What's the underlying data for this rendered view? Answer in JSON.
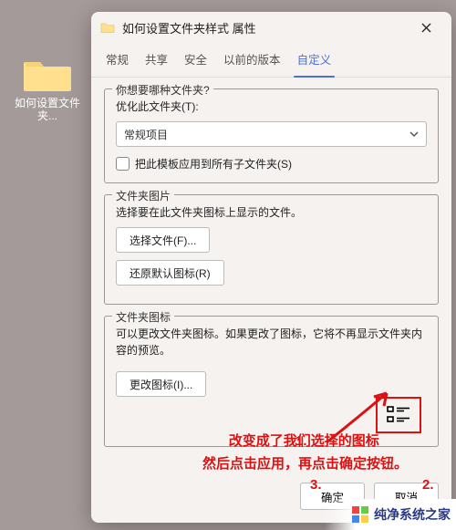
{
  "desktop": {
    "folder_label": "如何设置文件夹..."
  },
  "window": {
    "title": "如何设置文件夹样式 属性",
    "tabs": [
      "常规",
      "共享",
      "安全",
      "以前的版本",
      "自定义"
    ],
    "active_tab": 4,
    "group_template": {
      "legend": "你想要哪种文件夹?",
      "optimize_label": "优化此文件夹(T):",
      "select_value": "常规项目",
      "apply_cb_label": "把此模板应用到所有子文件夹(S)"
    },
    "group_picture": {
      "legend": "文件夹图片",
      "desc": "选择要在此文件夹图标上显示的文件。",
      "btn_choose": "选择文件(F)...",
      "btn_restore": "还原默认图标(R)"
    },
    "group_icon": {
      "legend": "文件夹图标",
      "desc": "可以更改文件夹图标。如果更改了图标，它将不再显示文件夹内容的预览。",
      "btn_change": "更改图标(I)..."
    },
    "buttons": {
      "ok": "确定",
      "cancel": "取消"
    }
  },
  "annotation": {
    "num1": "1.",
    "num2": "2.",
    "num3": "3.",
    "line1": "改变成了我们选择的图标",
    "line2": "然后点击应用，再点击确定按钮。"
  },
  "watermark": "纯净系统之家"
}
